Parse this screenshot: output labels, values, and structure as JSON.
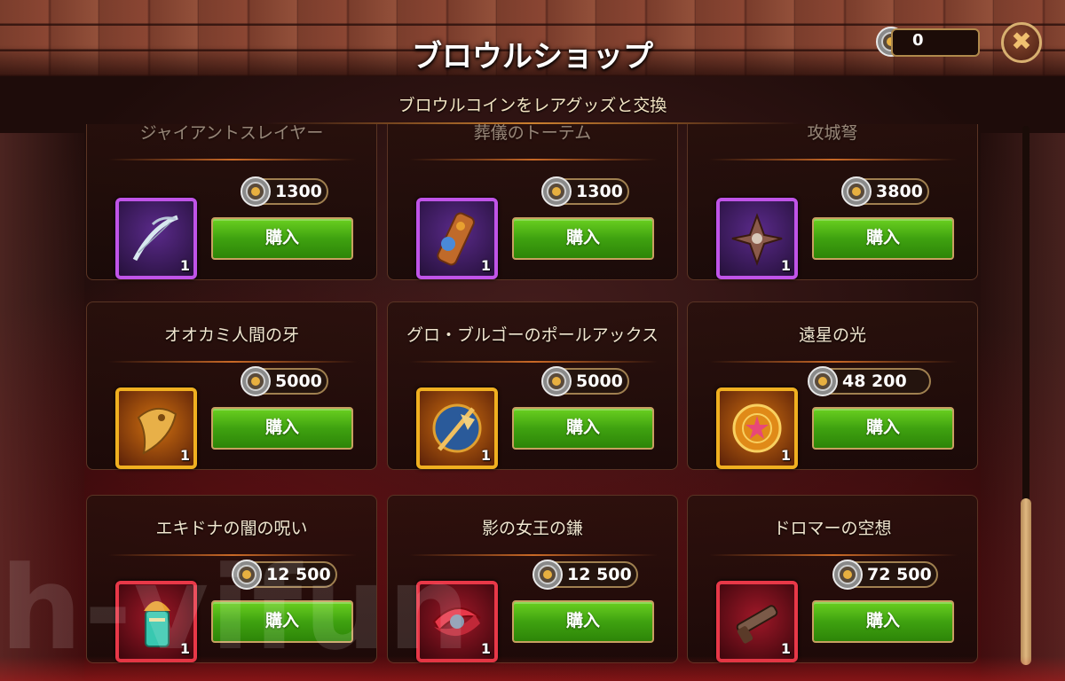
{
  "header": {
    "title": "ブロウルショップ",
    "subtitle": "ブロウルコインをレアグッズと交換",
    "currency_value": "0",
    "close_label": "✖"
  },
  "shop": {
    "items": [
      {
        "name": "ジャイアントスレイヤー",
        "price": "1300",
        "qty": "1",
        "rarity": "purple",
        "icon": "bow-icon",
        "buy_label": "購入"
      },
      {
        "name": "葬儀のトーテム",
        "price": "1300",
        "qty": "1",
        "rarity": "purple",
        "icon": "totem-icon",
        "buy_label": "購入"
      },
      {
        "name": "攻城弩",
        "price": "3800",
        "qty": "1",
        "rarity": "purple",
        "icon": "crossbow-icon",
        "buy_label": "購入"
      },
      {
        "name": "オオカミ人間の牙",
        "price": "5000",
        "qty": "1",
        "rarity": "gold",
        "icon": "fang-icon",
        "buy_label": "購入"
      },
      {
        "name": "グロ・ブルゴーのポールアックス",
        "price": "5000",
        "qty": "1",
        "rarity": "gold",
        "icon": "poleaxe-icon",
        "buy_label": "購入"
      },
      {
        "name": "遠星の光",
        "price": "48 200",
        "qty": "1",
        "rarity": "gold",
        "icon": "star-medallion-icon",
        "buy_label": "購入"
      },
      {
        "name": "エキドナの闇の呪い",
        "price": "12 500",
        "qty": "1",
        "rarity": "red",
        "icon": "curse-vial-icon",
        "buy_label": "購入"
      },
      {
        "name": "影の女王の鎌",
        "price": "12 500",
        "qty": "1",
        "rarity": "red",
        "icon": "scythe-icon",
        "buy_label": "購入"
      },
      {
        "name": "ドロマーの空想",
        "price": "72 500",
        "qty": "1",
        "rarity": "red",
        "icon": "gun-icon",
        "buy_label": "購入"
      }
    ]
  },
  "watermark": "h-vifun",
  "colors": {
    "buy_green": "#3fa210",
    "purple_frame": "#c054e8",
    "gold_frame": "#f0b020",
    "red_frame": "#e83848"
  }
}
